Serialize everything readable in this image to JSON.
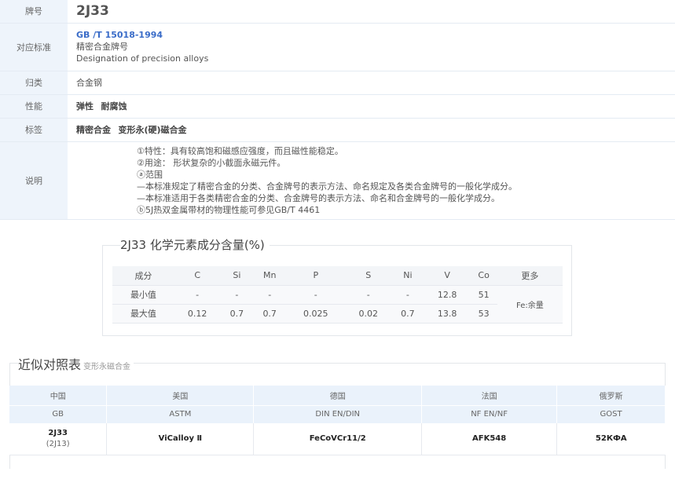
{
  "props": {
    "grade": {
      "label": "牌号",
      "value": "2J33"
    },
    "standard": {
      "label": "对应标准",
      "code": "GB /T 15018-1994",
      "name_cn": "精密合金牌号",
      "name_en": "Designation of precision alloys"
    },
    "category": {
      "label": "归类",
      "value": "合金钢"
    },
    "property": {
      "label": "性能",
      "values": [
        "弹性",
        "耐腐蚀"
      ]
    },
    "tags": {
      "label": "标签",
      "values": [
        "精密合金",
        "变形永(硬)磁合金"
      ]
    },
    "description": {
      "label": "说明",
      "lines": [
        "①特性：具有较高饱和磁感应强度，而且磁性能稳定。",
        "②用途：  形状复杂的小截面永磁元件。",
        "ⓐ范围",
        "—本标准规定了精密合金的分类、合金牌号的表示方法、命名规定及各类合金牌号的一般化学成分。",
        "—本标准适用于各类精密合金的分类、合金牌号的表示方法、命名和合金牌号的一般化学成分。",
        "ⓑ5J热双金属带材的物理性能可参见GB/T 4461"
      ]
    }
  },
  "chem": {
    "title": "2J33 化学元素成分含量(%)",
    "header": [
      "成分",
      "C",
      "Si",
      "Mn",
      "P",
      "S",
      "Ni",
      "V",
      "Co",
      "更多"
    ],
    "min_row": [
      "最小值",
      "-",
      "-",
      "-",
      "-",
      "-",
      "-",
      "12.8",
      "51"
    ],
    "max_row": [
      "最大值",
      "0.12",
      "0.7",
      "0.7",
      "0.025",
      "0.02",
      "0.7",
      "13.8",
      "53"
    ],
    "more": "Fe:余量"
  },
  "compare": {
    "title": "近似对照表",
    "subtitle": "变形永磁合金",
    "countries": [
      "中国",
      "美国",
      "德国",
      "法国",
      "俄罗斯"
    ],
    "standards": [
      "GB",
      "ASTM",
      "DIN EN/DIN",
      "NF EN/NF",
      "GOST"
    ],
    "grades": [
      "2J33",
      "ViCalloy Ⅱ",
      "FeCoVCr11/2",
      "AFK548",
      "52КФА"
    ],
    "alt": "(2J13)"
  }
}
